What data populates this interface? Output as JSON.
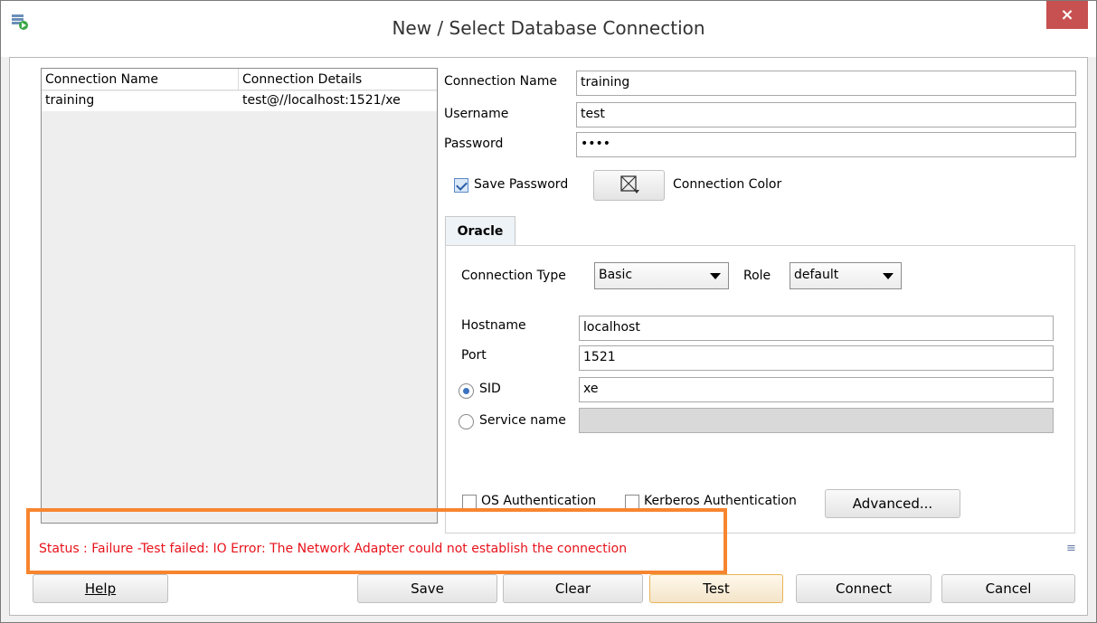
{
  "window": {
    "title": "New / Select Database Connection",
    "close_label": "×"
  },
  "connections": {
    "headers": [
      "Connection Name",
      "Connection Details"
    ],
    "rows": [
      {
        "name": "training",
        "details": "test@//localhost:1521/xe"
      }
    ]
  },
  "form": {
    "connection_name_label": "Connection Name",
    "connection_name_value": "training",
    "username_label": "Username",
    "username_value": "test",
    "password_label": "Password",
    "password_value": "••••",
    "save_password_label": "Save Password",
    "save_password_checked": true,
    "connection_color_label": "Connection Color"
  },
  "oracle": {
    "tab_label": "Oracle",
    "connection_type_label": "Connection Type",
    "connection_type_value": "Basic",
    "role_label": "Role",
    "role_value": "default",
    "hostname_label": "Hostname",
    "hostname_value": "localhost",
    "port_label": "Port",
    "port_value": "1521",
    "sid_label": "SID",
    "sid_value": "xe",
    "service_name_label": "Service name",
    "service_name_value": "",
    "os_auth_label": "OS Authentication",
    "kerberos_auth_label": "Kerberos Authentication",
    "advanced_label": "Advanced..."
  },
  "status": {
    "text": "Status : Failure -Test failed: IO Error: The Network Adapter could not establish the connection",
    "color": "#e8121a",
    "highlight_color": "#f7852f"
  },
  "buttons": {
    "help": "Help",
    "save": "Save",
    "clear": "Clear",
    "test": "Test",
    "connect": "Connect",
    "cancel": "Cancel"
  },
  "icons": {
    "app": "database-connection-icon",
    "color": "color-picker-icon",
    "side": "list-icon"
  }
}
